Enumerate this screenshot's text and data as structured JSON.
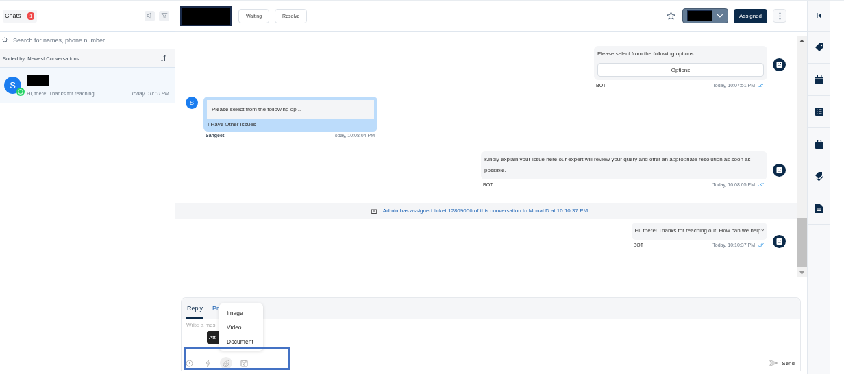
{
  "sidebar": {
    "title": "Chats -",
    "unread_count": "1",
    "search": {
      "placeholder": "Search for names, phone number"
    },
    "sort_label": "Sorted by: Newest Conversations",
    "conversations": [
      {
        "avatar_letter": "S",
        "preview": "Hi, there! Thanks for reaching...",
        "time": "Today, 10:10 PM",
        "selected": true
      }
    ]
  },
  "header": {
    "buttons": [
      "Waiting",
      "Resolve"
    ],
    "starred": false,
    "status_button": "Assigned"
  },
  "messages": [
    {
      "kind": "bot",
      "text": "Please select from the following options",
      "option_button": "Options",
      "sender": "BOT",
      "time": "Today, 10:07:51 PM",
      "read": true
    },
    {
      "kind": "user",
      "avatar_letter": "S",
      "quoted": "Please select from the following op...",
      "text": "I Have Other Issues",
      "sender": "Sangeet",
      "time": "Today, 10:08:04 PM"
    },
    {
      "kind": "bot",
      "text": "Kindly explain your issue here our expert will review your query and offer an appropriate resolution as soon as possible.",
      "sender": "BOT",
      "time": "Today, 10:08:05 PM",
      "read": true
    },
    {
      "kind": "system",
      "text": "Admin has assigned ticket 12809066 of this conversation to Monal D at 10:10:37 PM"
    },
    {
      "kind": "bot",
      "text": "Hi, there! Thanks for reaching out. How can we help?",
      "sender": "BOT",
      "time": "Today, 10:10:37 PM",
      "read": true
    }
  ],
  "composer": {
    "tabs": [
      {
        "label": "Reply",
        "selected": true
      },
      {
        "label": "Pri",
        "selected": false
      }
    ],
    "placeholder": "Write a mes",
    "tooltip": "Att",
    "attach_menu": [
      "Image",
      "Video",
      "Document"
    ],
    "send_button": "Send"
  }
}
